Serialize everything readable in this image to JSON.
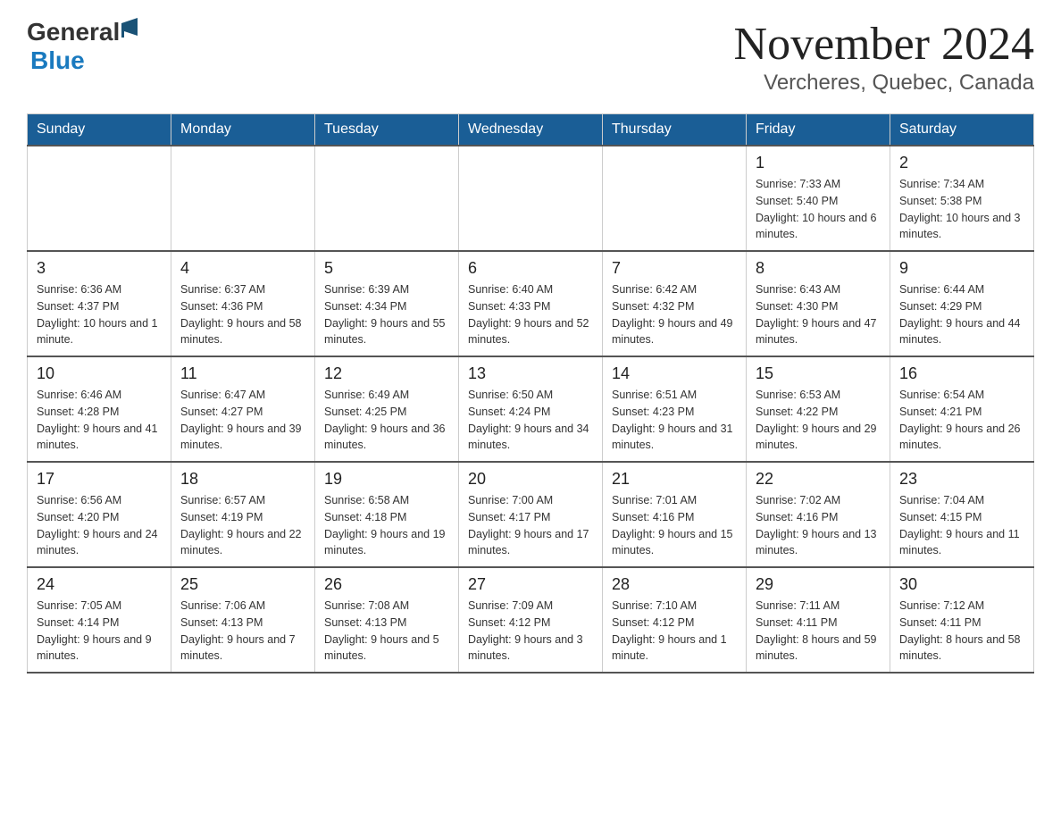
{
  "logo": {
    "general": "General",
    "blue": "Blue"
  },
  "title": "November 2024",
  "subtitle": "Vercheres, Quebec, Canada",
  "days_of_week": [
    "Sunday",
    "Monday",
    "Tuesday",
    "Wednesday",
    "Thursday",
    "Friday",
    "Saturday"
  ],
  "weeks": [
    [
      {
        "day": "",
        "info": ""
      },
      {
        "day": "",
        "info": ""
      },
      {
        "day": "",
        "info": ""
      },
      {
        "day": "",
        "info": ""
      },
      {
        "day": "",
        "info": ""
      },
      {
        "day": "1",
        "info": "Sunrise: 7:33 AM\nSunset: 5:40 PM\nDaylight: 10 hours and 6 minutes."
      },
      {
        "day": "2",
        "info": "Sunrise: 7:34 AM\nSunset: 5:38 PM\nDaylight: 10 hours and 3 minutes."
      }
    ],
    [
      {
        "day": "3",
        "info": "Sunrise: 6:36 AM\nSunset: 4:37 PM\nDaylight: 10 hours and 1 minute."
      },
      {
        "day": "4",
        "info": "Sunrise: 6:37 AM\nSunset: 4:36 PM\nDaylight: 9 hours and 58 minutes."
      },
      {
        "day": "5",
        "info": "Sunrise: 6:39 AM\nSunset: 4:34 PM\nDaylight: 9 hours and 55 minutes."
      },
      {
        "day": "6",
        "info": "Sunrise: 6:40 AM\nSunset: 4:33 PM\nDaylight: 9 hours and 52 minutes."
      },
      {
        "day": "7",
        "info": "Sunrise: 6:42 AM\nSunset: 4:32 PM\nDaylight: 9 hours and 49 minutes."
      },
      {
        "day": "8",
        "info": "Sunrise: 6:43 AM\nSunset: 4:30 PM\nDaylight: 9 hours and 47 minutes."
      },
      {
        "day": "9",
        "info": "Sunrise: 6:44 AM\nSunset: 4:29 PM\nDaylight: 9 hours and 44 minutes."
      }
    ],
    [
      {
        "day": "10",
        "info": "Sunrise: 6:46 AM\nSunset: 4:28 PM\nDaylight: 9 hours and 41 minutes."
      },
      {
        "day": "11",
        "info": "Sunrise: 6:47 AM\nSunset: 4:27 PM\nDaylight: 9 hours and 39 minutes."
      },
      {
        "day": "12",
        "info": "Sunrise: 6:49 AM\nSunset: 4:25 PM\nDaylight: 9 hours and 36 minutes."
      },
      {
        "day": "13",
        "info": "Sunrise: 6:50 AM\nSunset: 4:24 PM\nDaylight: 9 hours and 34 minutes."
      },
      {
        "day": "14",
        "info": "Sunrise: 6:51 AM\nSunset: 4:23 PM\nDaylight: 9 hours and 31 minutes."
      },
      {
        "day": "15",
        "info": "Sunrise: 6:53 AM\nSunset: 4:22 PM\nDaylight: 9 hours and 29 minutes."
      },
      {
        "day": "16",
        "info": "Sunrise: 6:54 AM\nSunset: 4:21 PM\nDaylight: 9 hours and 26 minutes."
      }
    ],
    [
      {
        "day": "17",
        "info": "Sunrise: 6:56 AM\nSunset: 4:20 PM\nDaylight: 9 hours and 24 minutes."
      },
      {
        "day": "18",
        "info": "Sunrise: 6:57 AM\nSunset: 4:19 PM\nDaylight: 9 hours and 22 minutes."
      },
      {
        "day": "19",
        "info": "Sunrise: 6:58 AM\nSunset: 4:18 PM\nDaylight: 9 hours and 19 minutes."
      },
      {
        "day": "20",
        "info": "Sunrise: 7:00 AM\nSunset: 4:17 PM\nDaylight: 9 hours and 17 minutes."
      },
      {
        "day": "21",
        "info": "Sunrise: 7:01 AM\nSunset: 4:16 PM\nDaylight: 9 hours and 15 minutes."
      },
      {
        "day": "22",
        "info": "Sunrise: 7:02 AM\nSunset: 4:16 PM\nDaylight: 9 hours and 13 minutes."
      },
      {
        "day": "23",
        "info": "Sunrise: 7:04 AM\nSunset: 4:15 PM\nDaylight: 9 hours and 11 minutes."
      }
    ],
    [
      {
        "day": "24",
        "info": "Sunrise: 7:05 AM\nSunset: 4:14 PM\nDaylight: 9 hours and 9 minutes."
      },
      {
        "day": "25",
        "info": "Sunrise: 7:06 AM\nSunset: 4:13 PM\nDaylight: 9 hours and 7 minutes."
      },
      {
        "day": "26",
        "info": "Sunrise: 7:08 AM\nSunset: 4:13 PM\nDaylight: 9 hours and 5 minutes."
      },
      {
        "day": "27",
        "info": "Sunrise: 7:09 AM\nSunset: 4:12 PM\nDaylight: 9 hours and 3 minutes."
      },
      {
        "day": "28",
        "info": "Sunrise: 7:10 AM\nSunset: 4:12 PM\nDaylight: 9 hours and 1 minute."
      },
      {
        "day": "29",
        "info": "Sunrise: 7:11 AM\nSunset: 4:11 PM\nDaylight: 8 hours and 59 minutes."
      },
      {
        "day": "30",
        "info": "Sunrise: 7:12 AM\nSunset: 4:11 PM\nDaylight: 8 hours and 58 minutes."
      }
    ]
  ]
}
